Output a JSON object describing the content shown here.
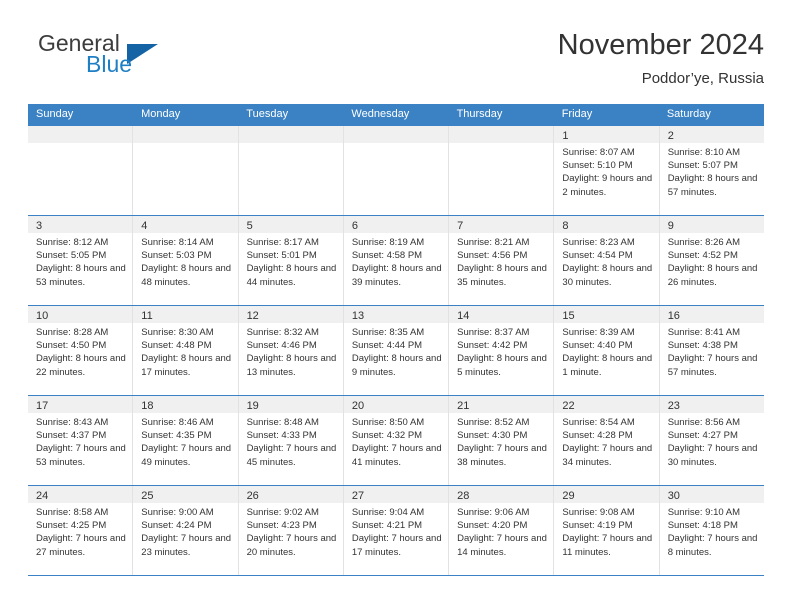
{
  "logo": {
    "word1": "General",
    "word2": "Blue"
  },
  "header": {
    "title": "November 2024",
    "subtitle": "Poddor’ye, Russia"
  },
  "colors": {
    "header_blue": "#3b82c4",
    "logo_blue": "#1f7fc4",
    "logo_triangle": "#1464a5",
    "day_band": "#f0f0f0",
    "text": "#333333"
  },
  "weekdays": [
    "Sunday",
    "Monday",
    "Tuesday",
    "Wednesday",
    "Thursday",
    "Friday",
    "Saturday"
  ],
  "weeks": [
    [
      {
        "day": "",
        "sunrise": "",
        "sunset": "",
        "daylight": "",
        "empty": true
      },
      {
        "day": "",
        "sunrise": "",
        "sunset": "",
        "daylight": "",
        "empty": true
      },
      {
        "day": "",
        "sunrise": "",
        "sunset": "",
        "daylight": "",
        "empty": true
      },
      {
        "day": "",
        "sunrise": "",
        "sunset": "",
        "daylight": "",
        "empty": true
      },
      {
        "day": "",
        "sunrise": "",
        "sunset": "",
        "daylight": "",
        "empty": true
      },
      {
        "day": "1",
        "sunrise": "Sunrise: 8:07 AM",
        "sunset": "Sunset: 5:10 PM",
        "daylight": "Daylight: 9 hours and 2 minutes."
      },
      {
        "day": "2",
        "sunrise": "Sunrise: 8:10 AM",
        "sunset": "Sunset: 5:07 PM",
        "daylight": "Daylight: 8 hours and 57 minutes."
      }
    ],
    [
      {
        "day": "3",
        "sunrise": "Sunrise: 8:12 AM",
        "sunset": "Sunset: 5:05 PM",
        "daylight": "Daylight: 8 hours and 53 minutes."
      },
      {
        "day": "4",
        "sunrise": "Sunrise: 8:14 AM",
        "sunset": "Sunset: 5:03 PM",
        "daylight": "Daylight: 8 hours and 48 minutes."
      },
      {
        "day": "5",
        "sunrise": "Sunrise: 8:17 AM",
        "sunset": "Sunset: 5:01 PM",
        "daylight": "Daylight: 8 hours and 44 minutes."
      },
      {
        "day": "6",
        "sunrise": "Sunrise: 8:19 AM",
        "sunset": "Sunset: 4:58 PM",
        "daylight": "Daylight: 8 hours and 39 minutes."
      },
      {
        "day": "7",
        "sunrise": "Sunrise: 8:21 AM",
        "sunset": "Sunset: 4:56 PM",
        "daylight": "Daylight: 8 hours and 35 minutes."
      },
      {
        "day": "8",
        "sunrise": "Sunrise: 8:23 AM",
        "sunset": "Sunset: 4:54 PM",
        "daylight": "Daylight: 8 hours and 30 minutes."
      },
      {
        "day": "9",
        "sunrise": "Sunrise: 8:26 AM",
        "sunset": "Sunset: 4:52 PM",
        "daylight": "Daylight: 8 hours and 26 minutes."
      }
    ],
    [
      {
        "day": "10",
        "sunrise": "Sunrise: 8:28 AM",
        "sunset": "Sunset: 4:50 PM",
        "daylight": "Daylight: 8 hours and 22 minutes."
      },
      {
        "day": "11",
        "sunrise": "Sunrise: 8:30 AM",
        "sunset": "Sunset: 4:48 PM",
        "daylight": "Daylight: 8 hours and 17 minutes."
      },
      {
        "day": "12",
        "sunrise": "Sunrise: 8:32 AM",
        "sunset": "Sunset: 4:46 PM",
        "daylight": "Daylight: 8 hours and 13 minutes."
      },
      {
        "day": "13",
        "sunrise": "Sunrise: 8:35 AM",
        "sunset": "Sunset: 4:44 PM",
        "daylight": "Daylight: 8 hours and 9 minutes."
      },
      {
        "day": "14",
        "sunrise": "Sunrise: 8:37 AM",
        "sunset": "Sunset: 4:42 PM",
        "daylight": "Daylight: 8 hours and 5 minutes."
      },
      {
        "day": "15",
        "sunrise": "Sunrise: 8:39 AM",
        "sunset": "Sunset: 4:40 PM",
        "daylight": "Daylight: 8 hours and 1 minute."
      },
      {
        "day": "16",
        "sunrise": "Sunrise: 8:41 AM",
        "sunset": "Sunset: 4:38 PM",
        "daylight": "Daylight: 7 hours and 57 minutes."
      }
    ],
    [
      {
        "day": "17",
        "sunrise": "Sunrise: 8:43 AM",
        "sunset": "Sunset: 4:37 PM",
        "daylight": "Daylight: 7 hours and 53 minutes."
      },
      {
        "day": "18",
        "sunrise": "Sunrise: 8:46 AM",
        "sunset": "Sunset: 4:35 PM",
        "daylight": "Daylight: 7 hours and 49 minutes."
      },
      {
        "day": "19",
        "sunrise": "Sunrise: 8:48 AM",
        "sunset": "Sunset: 4:33 PM",
        "daylight": "Daylight: 7 hours and 45 minutes."
      },
      {
        "day": "20",
        "sunrise": "Sunrise: 8:50 AM",
        "sunset": "Sunset: 4:32 PM",
        "daylight": "Daylight: 7 hours and 41 minutes."
      },
      {
        "day": "21",
        "sunrise": "Sunrise: 8:52 AM",
        "sunset": "Sunset: 4:30 PM",
        "daylight": "Daylight: 7 hours and 38 minutes."
      },
      {
        "day": "22",
        "sunrise": "Sunrise: 8:54 AM",
        "sunset": "Sunset: 4:28 PM",
        "daylight": "Daylight: 7 hours and 34 minutes."
      },
      {
        "day": "23",
        "sunrise": "Sunrise: 8:56 AM",
        "sunset": "Sunset: 4:27 PM",
        "daylight": "Daylight: 7 hours and 30 minutes."
      }
    ],
    [
      {
        "day": "24",
        "sunrise": "Sunrise: 8:58 AM",
        "sunset": "Sunset: 4:25 PM",
        "daylight": "Daylight: 7 hours and 27 minutes."
      },
      {
        "day": "25",
        "sunrise": "Sunrise: 9:00 AM",
        "sunset": "Sunset: 4:24 PM",
        "daylight": "Daylight: 7 hours and 23 minutes."
      },
      {
        "day": "26",
        "sunrise": "Sunrise: 9:02 AM",
        "sunset": "Sunset: 4:23 PM",
        "daylight": "Daylight: 7 hours and 20 minutes."
      },
      {
        "day": "27",
        "sunrise": "Sunrise: 9:04 AM",
        "sunset": "Sunset: 4:21 PM",
        "daylight": "Daylight: 7 hours and 17 minutes."
      },
      {
        "day": "28",
        "sunrise": "Sunrise: 9:06 AM",
        "sunset": "Sunset: 4:20 PM",
        "daylight": "Daylight: 7 hours and 14 minutes."
      },
      {
        "day": "29",
        "sunrise": "Sunrise: 9:08 AM",
        "sunset": "Sunset: 4:19 PM",
        "daylight": "Daylight: 7 hours and 11 minutes."
      },
      {
        "day": "30",
        "sunrise": "Sunrise: 9:10 AM",
        "sunset": "Sunset: 4:18 PM",
        "daylight": "Daylight: 7 hours and 8 minutes."
      }
    ]
  ]
}
